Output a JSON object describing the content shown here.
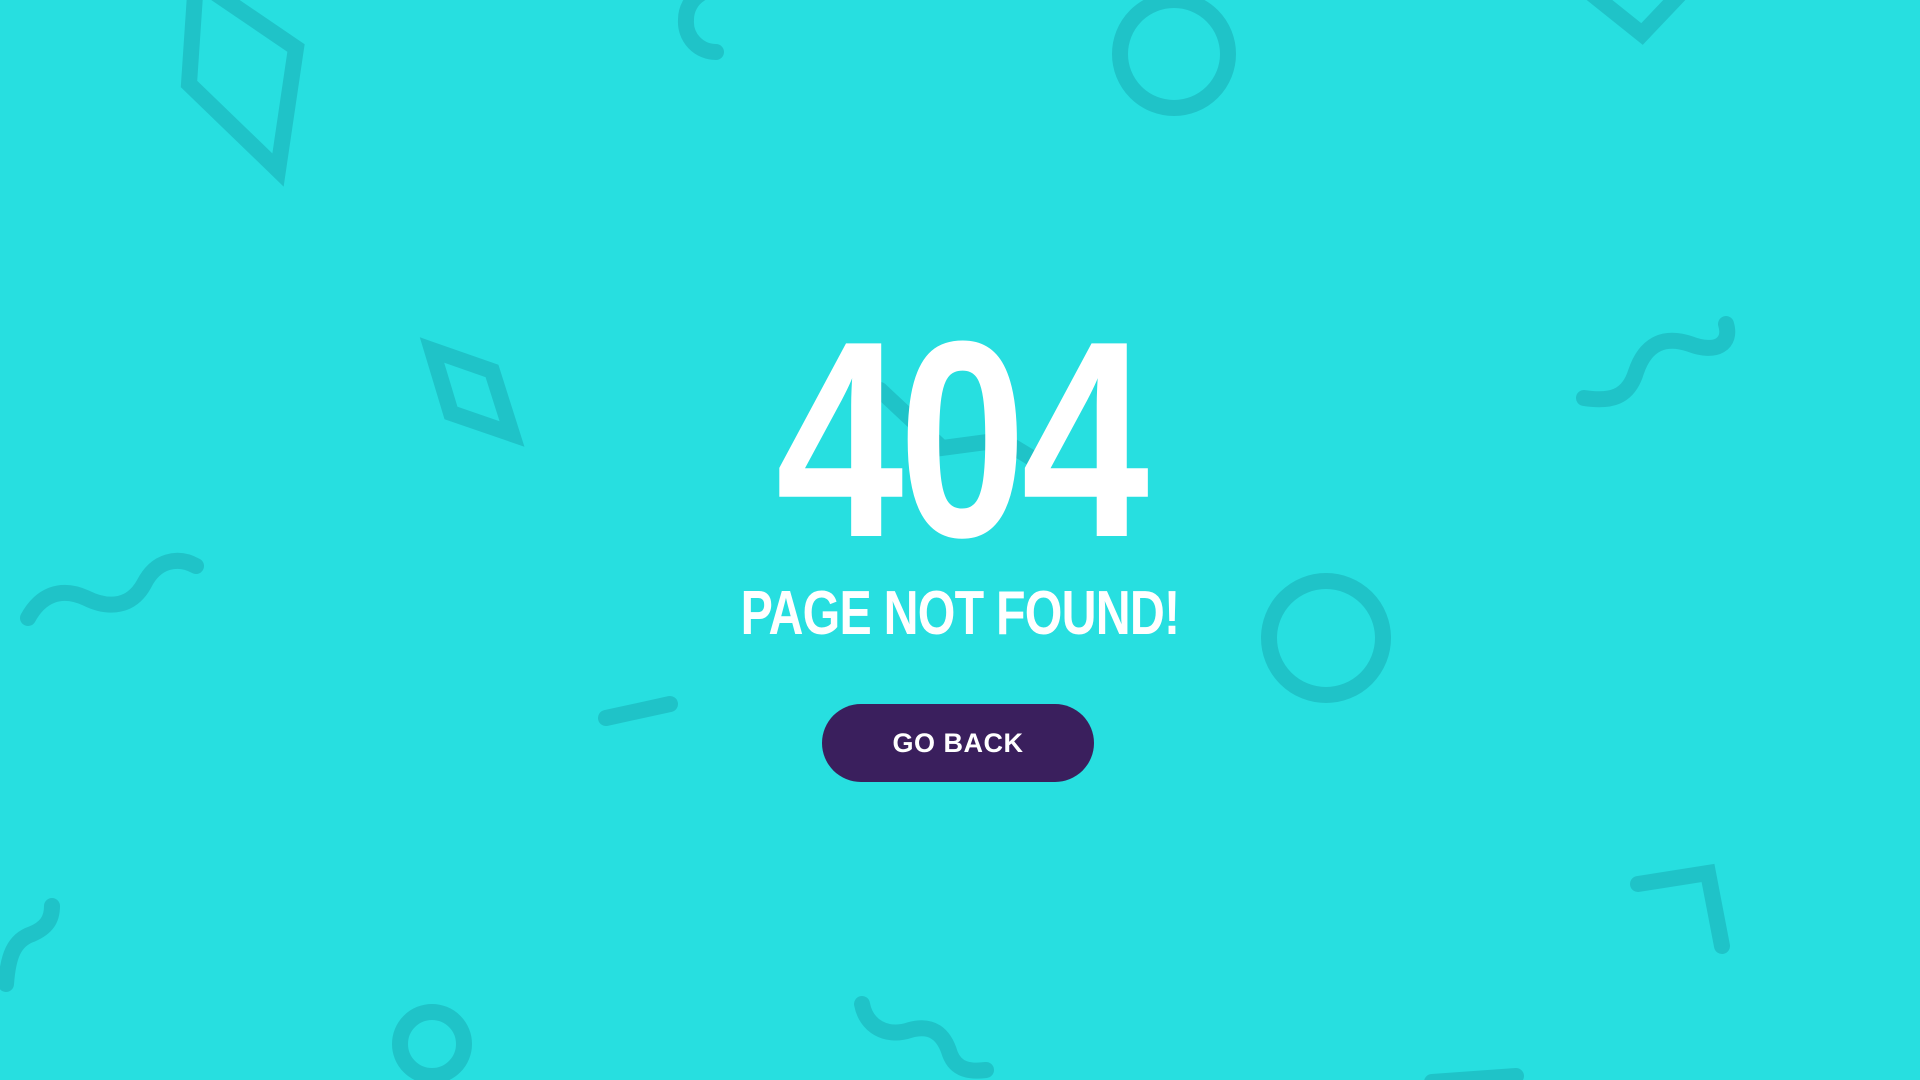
{
  "error": {
    "code": "404",
    "message": "PAGE NOT FOUND!",
    "button_label": "GO BACK"
  },
  "colors": {
    "background": "#27dfe0",
    "decor_shape": "#1fc3c8",
    "text": "#ffffff",
    "button": "#3a1f5d"
  },
  "decorations": [
    "diamond-outline-icon",
    "arc-icon",
    "circle-outline-icon",
    "chevron-icon",
    "squiggle-icon",
    "dash-icon",
    "corner-bracket-icon"
  ]
}
